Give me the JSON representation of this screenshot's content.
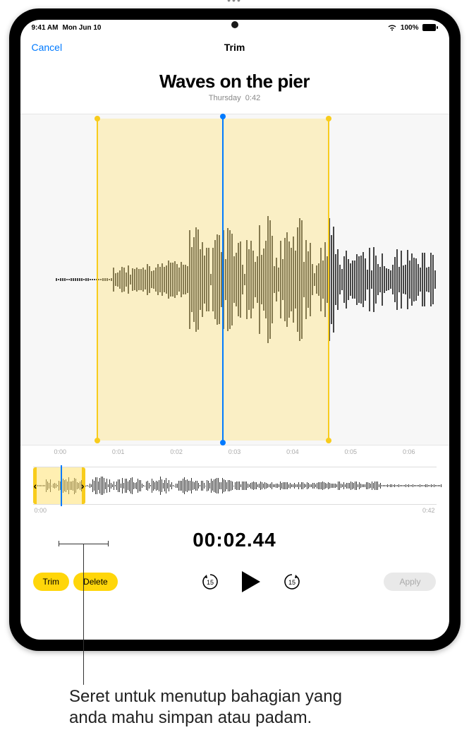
{
  "status": {
    "time": "9:41 AM",
    "date": "Mon Jun 10",
    "battery": "100%"
  },
  "nav": {
    "cancel": "Cancel",
    "title": "Trim",
    "more": "•••"
  },
  "recording": {
    "title": "Waves on the pier",
    "day": "Thursday",
    "duration": "0:42"
  },
  "timeline": {
    "markers": [
      "0:00",
      "0:01",
      "0:02",
      "0:03",
      "0:04",
      "0:05",
      "0:06"
    ],
    "mini_start": "0:00",
    "mini_end": "0:42"
  },
  "playback": {
    "current_time": "00:02.44",
    "skip_back_seconds": "15",
    "skip_fwd_seconds": "15"
  },
  "buttons": {
    "trim": "Trim",
    "delete": "Delete",
    "apply": "Apply"
  },
  "caption": "Seret untuk menutup bahagian yang anda mahu simpan atau padam."
}
